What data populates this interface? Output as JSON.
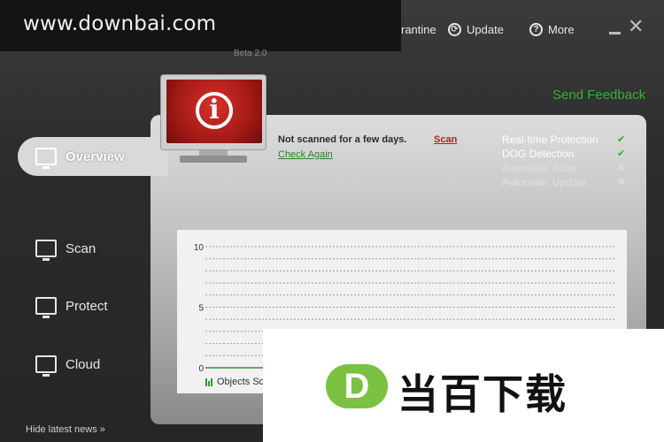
{
  "watermark": "www.downbai.com",
  "header": {
    "beta": "Beta 2.0",
    "nav": [
      {
        "label": "rantine",
        "icon": "quarantine-icon"
      },
      {
        "label": "Update",
        "icon": "update-icon"
      },
      {
        "label": "More",
        "icon": "help-icon"
      }
    ]
  },
  "feedback": "Send Feedback",
  "sidebar": {
    "items": [
      {
        "label": "Overview",
        "icon": "monitor-chart-icon",
        "active": true
      },
      {
        "label": "Scan",
        "icon": "monitor-search-icon"
      },
      {
        "label": "Protect",
        "icon": "monitor-shield-icon"
      },
      {
        "label": "Cloud",
        "icon": "monitor-cloud-icon"
      }
    ],
    "hide_news": "Hide latest news »"
  },
  "status": {
    "message": "Not scanned for a few days.",
    "check_again": "Check Again",
    "scan": "Scan"
  },
  "protection": [
    {
      "label": "Real-time Protection",
      "enabled": true
    },
    {
      "label": "DOG Detection",
      "enabled": true
    },
    {
      "label": "Automatic Scan",
      "enabled": false
    },
    {
      "label": "Automatic Update",
      "enabled": false
    }
  ],
  "chart_data": {
    "type": "line",
    "y_ticks": [
      "10",
      "5",
      "0"
    ],
    "ylim": [
      0,
      10
    ],
    "series": [
      {
        "name": "Objects Sc",
        "values": [
          0,
          0
        ]
      }
    ],
    "grid": true
  },
  "overlay": {
    "logo_letter": "D",
    "logo_text": "当百下载"
  },
  "colors": {
    "accent_green": "#2fb52f",
    "scan_red": "#b31f1f",
    "check_green": "#2fae2f"
  }
}
